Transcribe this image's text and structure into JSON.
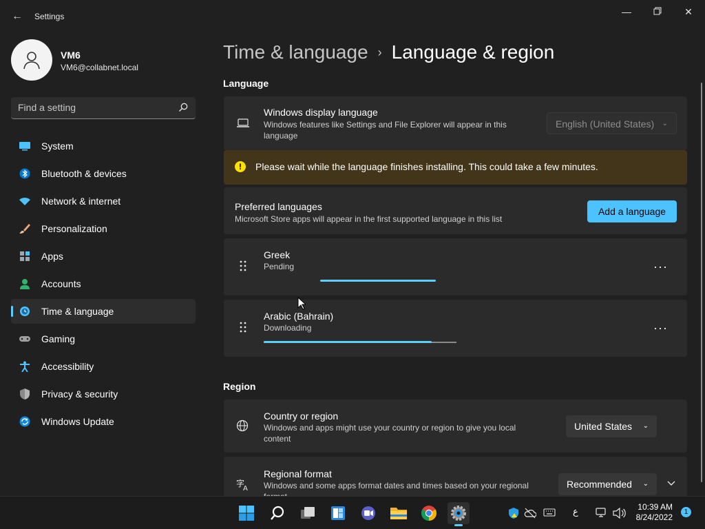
{
  "window": {
    "title": "Settings"
  },
  "user": {
    "name": "VM6",
    "email": "VM6@collabnet.local"
  },
  "search": {
    "placeholder": "Find a setting"
  },
  "nav": [
    {
      "label": "System",
      "icon": "system-icon"
    },
    {
      "label": "Bluetooth & devices",
      "icon": "bluetooth-icon"
    },
    {
      "label": "Network & internet",
      "icon": "wifi-icon"
    },
    {
      "label": "Personalization",
      "icon": "brush-icon"
    },
    {
      "label": "Apps",
      "icon": "apps-icon"
    },
    {
      "label": "Accounts",
      "icon": "accounts-icon"
    },
    {
      "label": "Time & language",
      "icon": "clock-globe-icon",
      "selected": true
    },
    {
      "label": "Gaming",
      "icon": "gamepad-icon"
    },
    {
      "label": "Accessibility",
      "icon": "accessibility-icon"
    },
    {
      "label": "Privacy & security",
      "icon": "shield-icon"
    },
    {
      "label": "Windows Update",
      "icon": "update-icon"
    }
  ],
  "breadcrumb": {
    "parent": "Time & language",
    "separator": "›",
    "current": "Language & region"
  },
  "language_section": {
    "title": "Language",
    "display_language": {
      "title": "Windows display language",
      "description": "Windows features like Settings and File Explorer will appear in this language",
      "value": "English (United States)"
    },
    "warning": "Please wait while the language finishes installing. This could take a few minutes.",
    "preferred": {
      "title": "Preferred languages",
      "description": "Microsoft Store apps will appear in the first supported language in this list",
      "add_button": "Add a language"
    },
    "languages": [
      {
        "name": "Greek",
        "status": "Pending",
        "progress": 0.4,
        "indeterminate": true
      },
      {
        "name": "Arabic (Bahrain)",
        "status": "Downloading",
        "progress": 0.87
      }
    ]
  },
  "region_section": {
    "title": "Region",
    "country": {
      "title": "Country or region",
      "description": "Windows and apps might use your country or region to give you local content",
      "value": "United States"
    },
    "format": {
      "title": "Regional format",
      "description": "Windows and some apps format dates and times based on your regional format",
      "value": "Recommended"
    }
  },
  "taskbar": {
    "apps": [
      "start-icon",
      "search-icon",
      "task-view-icon",
      "widgets-icon",
      "chat-icon",
      "file-explorer-icon",
      "chrome-icon",
      "settings-icon"
    ],
    "ime_char": "ع",
    "time": "10:39 AM",
    "date": "8/24/2022",
    "notification_count": "1"
  },
  "colors": {
    "accent": "#60cdff",
    "button": "#4cc2ff",
    "warning_bg": "#433519",
    "warning_icon": "#fce100"
  }
}
